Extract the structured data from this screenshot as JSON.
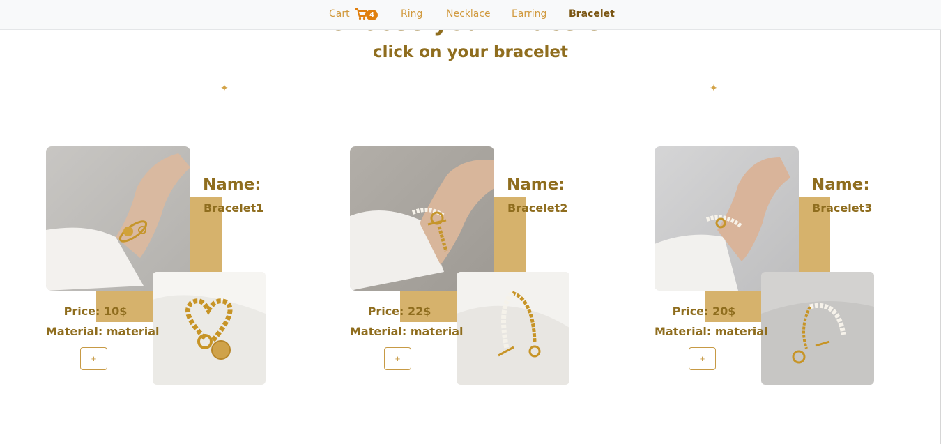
{
  "nav": {
    "cart_label": "Cart",
    "cart_count": "4",
    "items": [
      "Ring",
      "Necklace",
      "Earring",
      "Bracelet"
    ],
    "active": "Bracelet"
  },
  "page": {
    "title": "Choose your Bracelet",
    "subtitle": "click on your bracelet"
  },
  "products": [
    {
      "name_label": "Name:",
      "name": "Bracelet1",
      "price": "Price: 10$",
      "material": "Material: material",
      "add_label": "+"
    },
    {
      "name_label": "Name:",
      "name": "Bracelet2",
      "price": "Price: 22$",
      "material": "Material: material",
      "add_label": "+"
    },
    {
      "name_label": "Name:",
      "name": "Bracelet3",
      "price": "Price: 20$",
      "material": "Material: material",
      "add_label": "+"
    }
  ],
  "colors": {
    "brand_gold": "#8f6d1e",
    "accent_block": "#d6b26c",
    "nav_link": "#d19a3f",
    "badge": "#e07f0e"
  },
  "icons": {
    "cart": "cart-icon",
    "divider": "star-icon"
  }
}
